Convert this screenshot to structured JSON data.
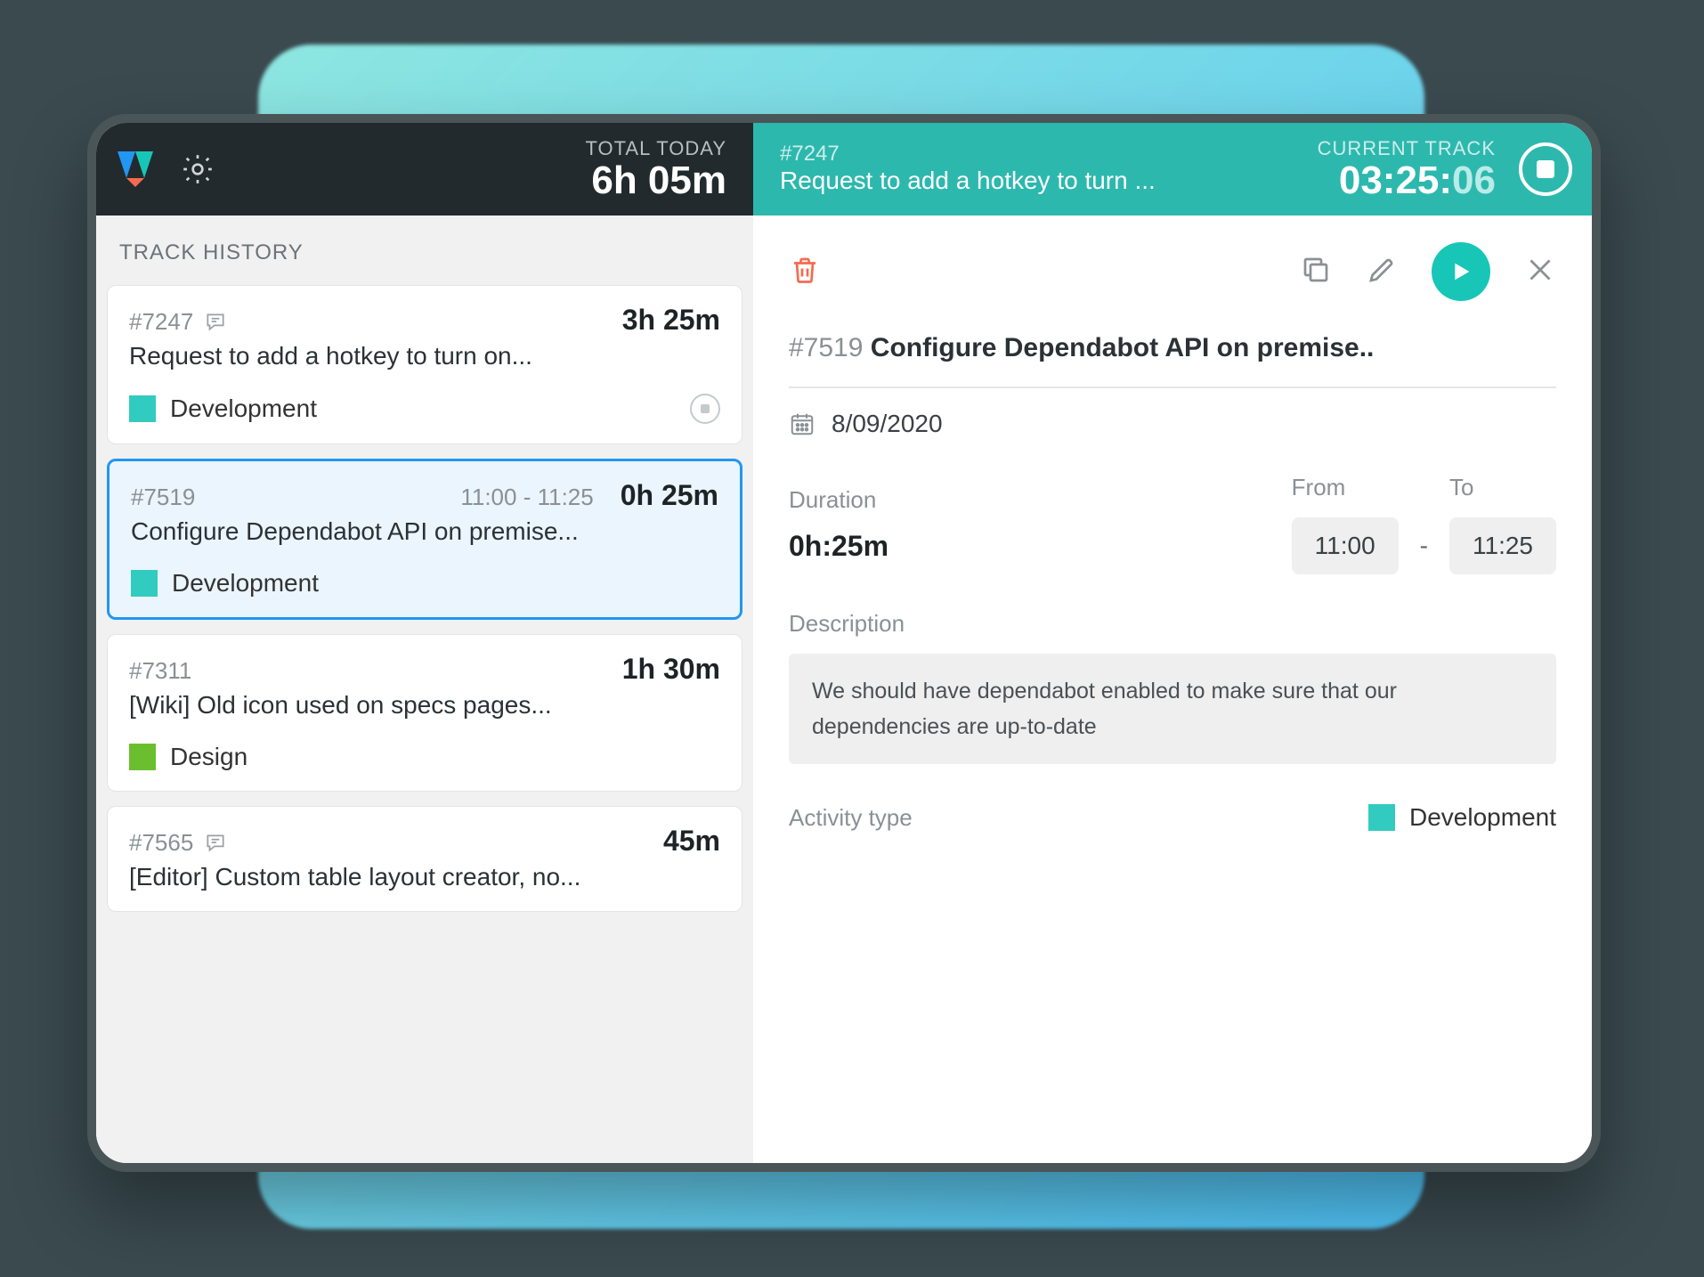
{
  "header": {
    "total_today_label": "TOTAL TODAY",
    "total_today_value": "6h 05m",
    "current_track_label": "CURRENT TRACK",
    "current_issue_id": "#7247",
    "current_issue_title": "Request to add a hotkey to turn ...",
    "current_timer_main": "03:25:",
    "current_timer_seconds": "06"
  },
  "sidebar": {
    "history_label": "TRACK HISTORY",
    "items": [
      {
        "id": "#7247",
        "title": "Request to add a hotkey to turn on...",
        "duration": "3h 25m",
        "time_range": "",
        "has_note": true,
        "activity": "Development",
        "color": "#32cbc0",
        "selected": false,
        "running": true
      },
      {
        "id": "#7519",
        "title": "Configure Dependabot API on premise...",
        "duration": "0h 25m",
        "time_range": "11:00 - 11:25",
        "has_note": false,
        "activity": "Development",
        "color": "#32cbc0",
        "selected": true,
        "running": false
      },
      {
        "id": "#7311",
        "title": "[Wiki] Old icon used on specs pages...",
        "duration": "1h 30m",
        "time_range": "",
        "has_note": false,
        "activity": "Design",
        "color": "#6bbf2f",
        "selected": false,
        "running": false
      },
      {
        "id": "#7565",
        "title": "[Editor] Custom table layout creator, no...",
        "duration": "45m",
        "time_range": "",
        "has_note": true,
        "activity": "",
        "color": "",
        "selected": false,
        "running": false
      }
    ]
  },
  "detail": {
    "issue_id": "#7519",
    "issue_title": "Configure Dependabot API on premise..",
    "date": "8/09/2020",
    "duration_label": "Duration",
    "duration_value": "0h:25m",
    "from_label": "From",
    "from_value": "11:00",
    "to_label": "To",
    "to_value": "11:25",
    "description_label": "Description",
    "description_text": "We should have dependabot enabled to make sure that our dependencies are up-to-date",
    "activity_label": "Activity type",
    "activity_name": "Development",
    "activity_color": "#32cbc0"
  }
}
